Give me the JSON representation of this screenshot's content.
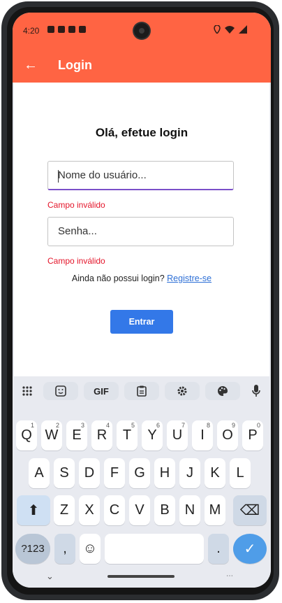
{
  "status_bar": {
    "time": "4:20"
  },
  "app_bar": {
    "back_icon": "arrow-left-icon",
    "title": "Login"
  },
  "login": {
    "heading": "Olá, efetue login",
    "username_placeholder": "Nome do usuário...",
    "username_error": "Campo inválido",
    "password_placeholder": "Senha...",
    "password_error": "Campo inválido",
    "register_prompt": "Ainda não possui login?",
    "register_link": "Registre-se",
    "submit_label": "Entrar"
  },
  "keyboard": {
    "toolbar": [
      "grid-icon",
      "sticker-icon",
      "GIF",
      "clipboard-icon",
      "gear-icon",
      "palette-icon",
      "microphone-icon"
    ],
    "gif_label": "GIF",
    "row1": [
      {
        "k": "Q",
        "h": "1"
      },
      {
        "k": "W",
        "h": "2"
      },
      {
        "k": "E",
        "h": "3"
      },
      {
        "k": "R",
        "h": "4"
      },
      {
        "k": "T",
        "h": "5"
      },
      {
        "k": "Y",
        "h": "6"
      },
      {
        "k": "U",
        "h": "7"
      },
      {
        "k": "I",
        "h": "8"
      },
      {
        "k": "O",
        "h": "9"
      },
      {
        "k": "P",
        "h": "0"
      }
    ],
    "row2": [
      "A",
      "S",
      "D",
      "F",
      "G",
      "H",
      "J",
      "K",
      "L"
    ],
    "row3": [
      "Z",
      "X",
      "C",
      "V",
      "B",
      "N",
      "M"
    ],
    "sym_label": "?123",
    "comma": ",",
    "period": ".",
    "emoji_glyph": "☺",
    "enter_glyph": "✓",
    "shift_glyph": "⬆",
    "backspace_glyph": "⌫"
  },
  "colors": {
    "accent": "#ff6443",
    "button": "#3378e8",
    "error": "#e4152a",
    "link": "#2d6fd6"
  }
}
